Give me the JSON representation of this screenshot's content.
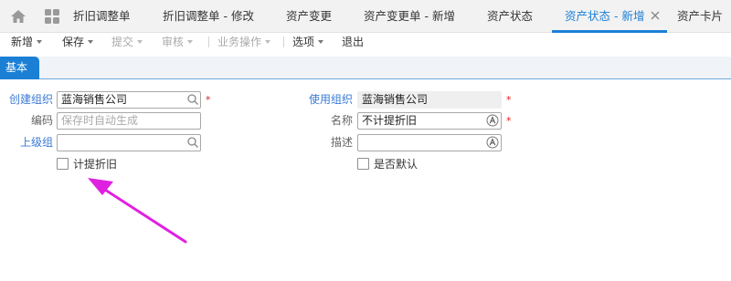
{
  "tabs": [
    {
      "label": "折旧调整单",
      "active": false
    },
    {
      "label": "折旧调整单 - 修改",
      "active": false
    },
    {
      "label": "资产变更",
      "active": false
    },
    {
      "label": "资产变更单 - 新增",
      "active": false
    },
    {
      "label": "资产状态",
      "active": false
    },
    {
      "label": "资产状态 - 新增",
      "active": true
    },
    {
      "label": "资产卡片",
      "active": false
    }
  ],
  "toolbar": {
    "new_label": "新增",
    "save_label": "保存",
    "submit_label": "提交",
    "audit_label": "审核",
    "business_label": "业务操作",
    "options_label": "选项",
    "exit_label": "退出"
  },
  "section": {
    "tab_label": "基本"
  },
  "form": {
    "create_org": {
      "label": "创建组织",
      "value": "蓝海销售公司"
    },
    "code": {
      "label": "编码",
      "placeholder": "保存时自动生成"
    },
    "parent_group": {
      "label": "上级组",
      "value": ""
    },
    "use_org": {
      "label": "使用组织",
      "value": "蓝海销售公司"
    },
    "name": {
      "label": "名称",
      "value": "不计提折旧"
    },
    "description": {
      "label": "描述",
      "value": ""
    },
    "depreciate_checkbox": {
      "label": "计提折旧",
      "checked": false
    },
    "default_checkbox": {
      "label": "是否默认",
      "checked": false
    },
    "required_mark": "*"
  },
  "colors": {
    "accent": "#1b7fd6",
    "link_label": "#3a7bd5",
    "required": "#e02020",
    "annotation_arrow": "#e020e0"
  }
}
